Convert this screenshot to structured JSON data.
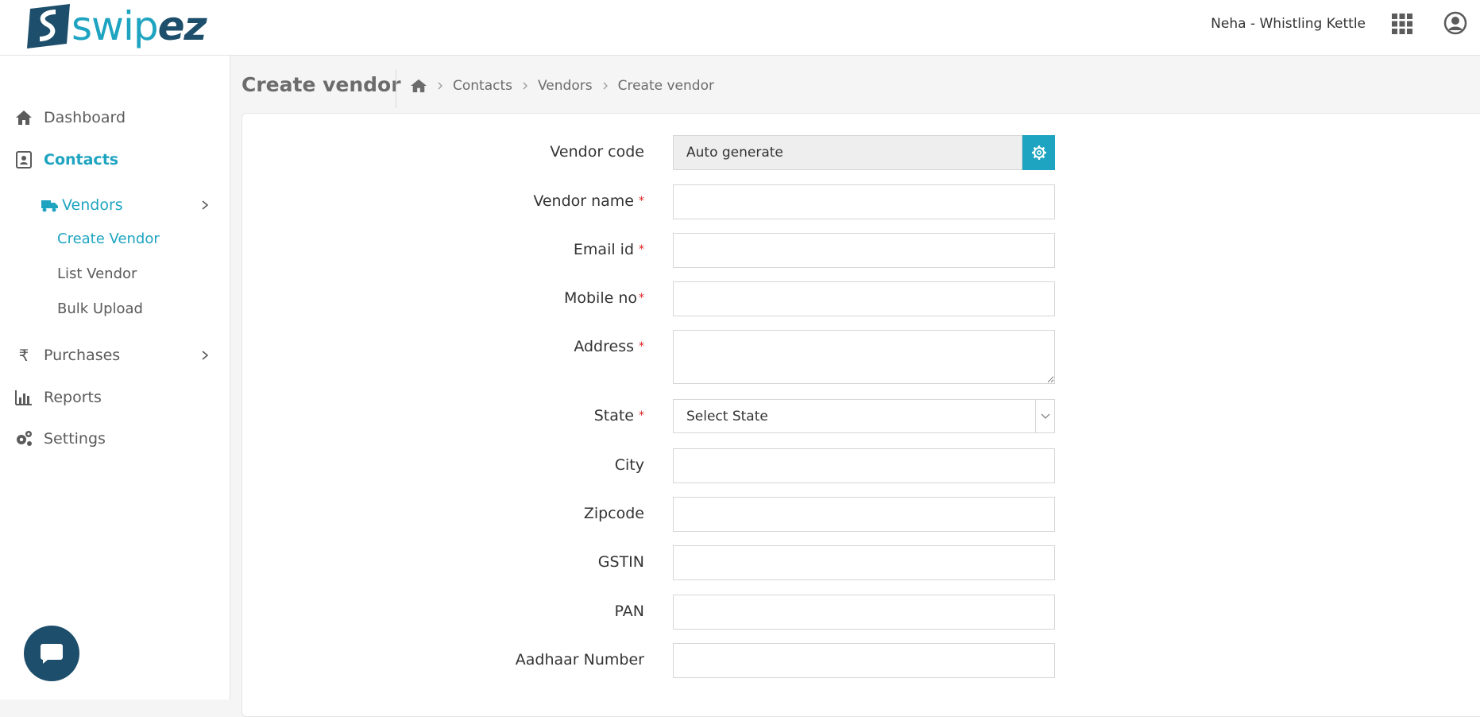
{
  "header": {
    "logo_text_1": "swip",
    "logo_text_2": "ez",
    "user_name": "Neha - Whistling Kettle",
    "icons": [
      "apps-grid-icon",
      "user-profile-icon"
    ]
  },
  "sidebar": {
    "items": [
      {
        "label": "Dashboard",
        "icon": "home-icon"
      },
      {
        "label": "Contacts",
        "icon": "contacts-icon"
      },
      {
        "label": "Purchases",
        "icon": "rupee-icon"
      },
      {
        "label": "Reports",
        "icon": "bar-chart-icon"
      },
      {
        "label": "Settings",
        "icon": "gears-icon"
      }
    ],
    "vendors": {
      "label": "Vendors",
      "icon": "truck-icon"
    },
    "vendor_sub": [
      "Create Vendor",
      "List Vendor",
      "Bulk Upload"
    ]
  },
  "page": {
    "title": "Create vendor",
    "breadcrumb": [
      "Contacts",
      "Vendors",
      "Create vendor"
    ]
  },
  "form": {
    "vendor_code": {
      "label": "Vendor code",
      "value": "Auto generate"
    },
    "vendor_name": {
      "label": "Vendor name",
      "required": "*"
    },
    "email": {
      "label": "Email id",
      "required": "*"
    },
    "mobile": {
      "label": "Mobile no",
      "required": "*"
    },
    "address": {
      "label": "Address",
      "required": "*"
    },
    "state": {
      "label": "State",
      "required": "*",
      "value": "Select State"
    },
    "city": {
      "label": "City"
    },
    "zipcode": {
      "label": "Zipcode"
    },
    "gstin": {
      "label": "GSTIN"
    },
    "pan": {
      "label": "PAN"
    },
    "aadhaar": {
      "label": "Aadhaar Number"
    }
  },
  "colors": {
    "accent": "#1ea4c0",
    "brand_dark": "#1d4e6b",
    "required": "#e02222"
  }
}
